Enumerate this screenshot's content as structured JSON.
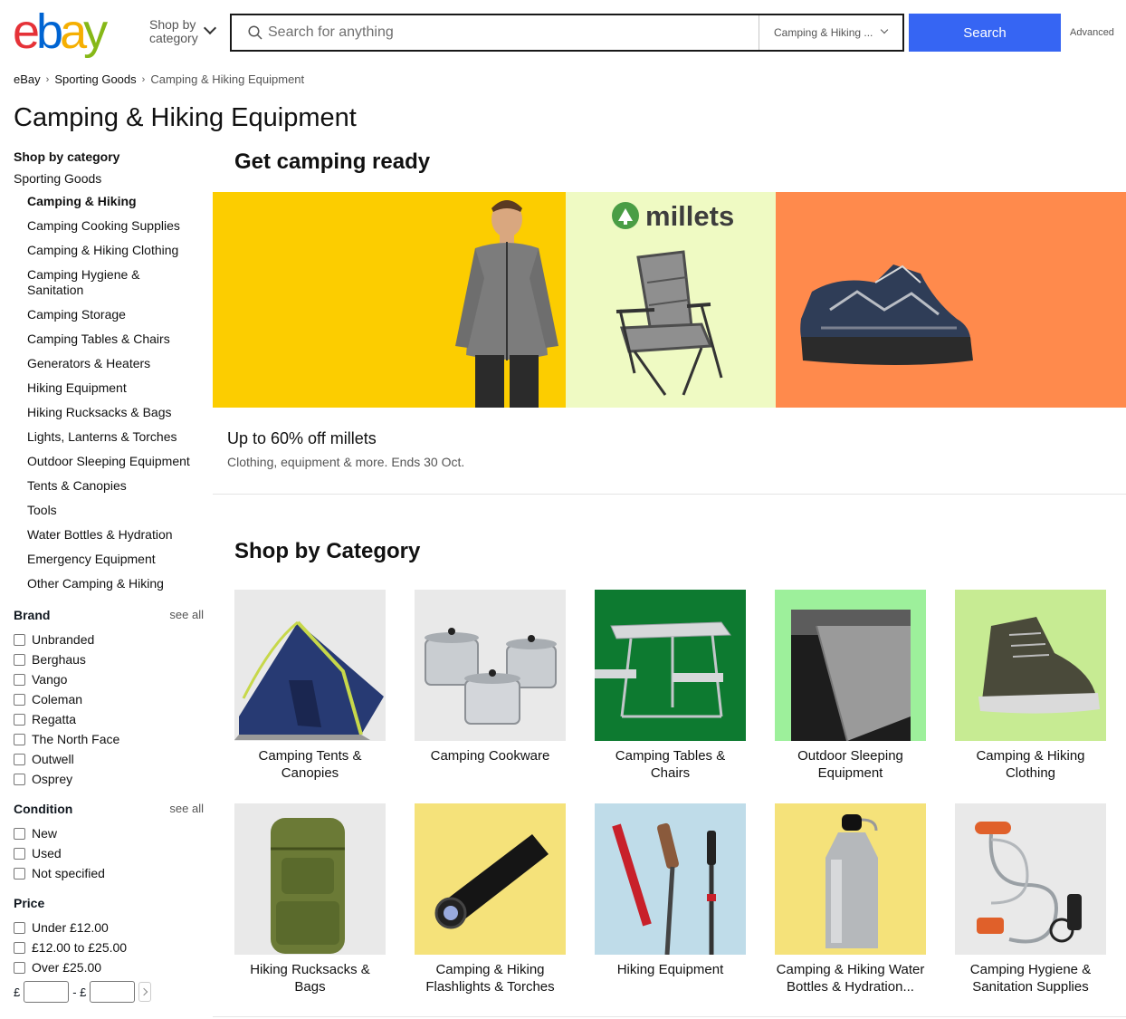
{
  "header": {
    "logo_letters": [
      "e",
      "b",
      "a",
      "y"
    ],
    "shop_by_line1": "Shop by",
    "shop_by_line2": "category",
    "search_placeholder": "Search for anything",
    "category_select": "Camping & Hiking ...",
    "search_button": "Search",
    "advanced": "Advanced"
  },
  "breadcrumb": [
    "eBay",
    "Sporting Goods",
    "Camping & Hiking Equipment"
  ],
  "page_title": "Camping & Hiking Equipment",
  "sidebar": {
    "heading": "Shop by category",
    "parent": "Sporting Goods",
    "items": [
      "Camping & Hiking",
      "Camping Cooking Supplies",
      "Camping & Hiking Clothing",
      "Camping Hygiene & Sanitation",
      "Camping Storage",
      "Camping Tables & Chairs",
      "Generators & Heaters",
      "Hiking Equipment",
      "Hiking Rucksacks & Bags",
      "Lights, Lanterns & Torches",
      "Outdoor Sleeping Equipment",
      "Tents & Canopies",
      "Tools",
      "Water Bottles & Hydration",
      "Emergency Equipment",
      "Other Camping & Hiking"
    ],
    "brand": {
      "heading": "Brand",
      "see_all": "see all",
      "options": [
        "Unbranded",
        "Berghaus",
        "Vango",
        "Coleman",
        "Regatta",
        "The North Face",
        "Outwell",
        "Osprey"
      ]
    },
    "condition": {
      "heading": "Condition",
      "see_all": "see all",
      "options": [
        "New",
        "Used",
        "Not specified"
      ]
    },
    "price": {
      "heading": "Price",
      "options": [
        "Under £12.00",
        "£12.00 to £25.00",
        "Over £25.00"
      ],
      "currency": "£",
      "range_sep": "- £"
    }
  },
  "promo": {
    "title": "Get camping ready",
    "brand_logo": "millets",
    "headline": "Up to 60% off millets",
    "subline": "Clothing, equipment & more. Ends 30 Oct.",
    "panel_colors": [
      "#fccd00",
      "#effac3",
      "#ff8a4c"
    ]
  },
  "shop_by_category": {
    "title": "Shop by Category",
    "tiles": [
      {
        "label": "Camping Tents & Canopies",
        "bg": "#e9e9e9",
        "icon": "tent-image"
      },
      {
        "label": "Camping Cookware",
        "bg": "#e9e9e9",
        "icon": "cookware-image"
      },
      {
        "label": "Camping Tables & Chairs",
        "bg": "#0d7a30",
        "icon": "table-image"
      },
      {
        "label": "Outdoor Sleeping Equipment",
        "bg": "#9df09b",
        "icon": "sleeping-bag-image"
      },
      {
        "label": "Camping & Hiking Clothing",
        "bg": "#c7eb93",
        "icon": "boot-image"
      },
      {
        "label": "Hiking Rucksacks & Bags",
        "bg": "#e9e9e9",
        "icon": "rucksack-image"
      },
      {
        "label": "Camping & Hiking Flashlights & Torches",
        "bg": "#f5e27a",
        "icon": "flashlight-image"
      },
      {
        "label": "Hiking Equipment",
        "bg": "#bfdce9",
        "icon": "trekking-poles-image"
      },
      {
        "label": "Camping & Hiking Water Bottles & Hydration...",
        "bg": "#f5e27a",
        "icon": "water-bottle-image"
      },
      {
        "label": "Camping Hygiene & Sanitation Supplies",
        "bg": "#e9e9e9",
        "icon": "shower-image"
      }
    ]
  }
}
